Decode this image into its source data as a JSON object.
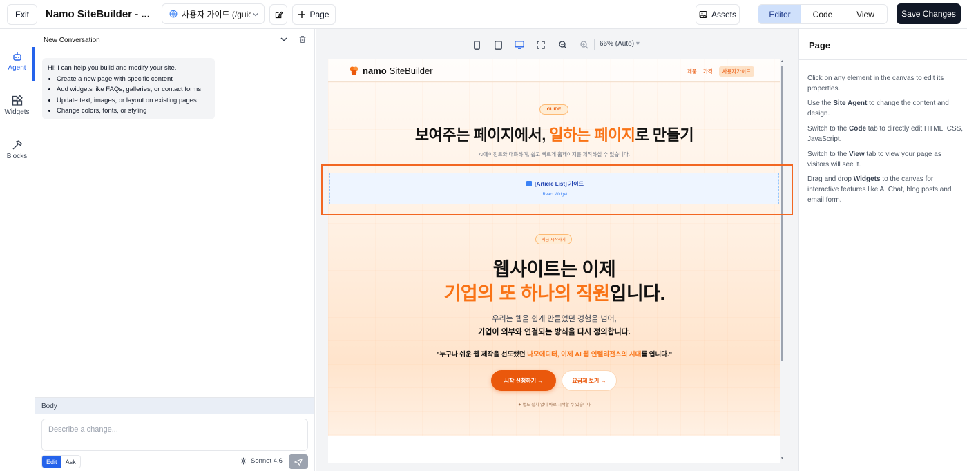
{
  "toolbar": {
    "exit_label": "Exit",
    "app_title": "Namo SiteBuilder - ...",
    "page_selector": "사용자 가이드 (/guide)",
    "add_page_label": "Page",
    "assets_label": "Assets",
    "view_modes": [
      "Editor",
      "Code",
      "View"
    ],
    "active_view_mode": "Editor",
    "save_label": "Save Changes"
  },
  "rail": {
    "items": [
      {
        "label": "Agent",
        "icon": "robot-icon",
        "active": true
      },
      {
        "label": "Widgets",
        "icon": "widgets-icon",
        "active": false
      },
      {
        "label": "Blocks",
        "icon": "hammer-icon",
        "active": false
      }
    ]
  },
  "conversation": {
    "title": "New Conversation",
    "greeting": "Hi! I can help you build and modify your site.",
    "suggestions": [
      "Create a new page with specific content",
      "Add widgets like FAQs, galleries, or contact forms",
      "Update text, images, or layout on existing pages",
      "Change colors, fonts, or styling"
    ],
    "context_label": "Body",
    "input_placeholder": "Describe a change...",
    "modes": [
      "Edit",
      "Ask"
    ],
    "active_mode": "Edit",
    "model": "Sonnet 4.6"
  },
  "canvas": {
    "zoom": "66% (Auto)",
    "site": {
      "logo_brand": "namo",
      "logo_name": "SiteBuilder",
      "nav": [
        "제품",
        "가격",
        "사용자가이드"
      ],
      "guide_badge": "GUIDE",
      "hero_title_a": "보여주는 페이지에서, ",
      "hero_title_highlight": "일하는 페이지",
      "hero_title_b": "로 만들기",
      "hero_subtitle": "AI에이전트와 대화하며, 쉽고 빠르게 홈페이지를 제작하실 수 있습니다.",
      "widget_title": "[Article List] 가이드",
      "widget_subtitle": "React Widget",
      "start_badge": "지금 시작하기",
      "headline_line1": "웹사이트는 이제",
      "headline_highlight": "기업의 또 하나의 직원",
      "headline_tail": "입니다.",
      "desc_line1": "우리는 웹을 쉽게 만들었던 경험을 넘어,",
      "desc_line2": "기업이 외부와 연결되는 방식을 다시 정의합니다.",
      "quote_a": "\"누구나 쉬운 웹 제작을 선도했던 ",
      "quote_highlight": "나모에디터, 이제 AI 웹 인텔리전스의 시대",
      "quote_b": "를 엽니다.\"",
      "cta_primary": "시작 신청하기 →",
      "cta_secondary": "요금제 보기 →",
      "note": "✦ 별도 설치 없이 바로 시작할 수 있습니다"
    }
  },
  "properties": {
    "title": "Page",
    "tips": [
      {
        "parts": [
          {
            "t": "Click on any element in the canvas to edit its properties.",
            "b": false
          }
        ]
      },
      {
        "parts": [
          {
            "t": "Use the ",
            "b": false
          },
          {
            "t": "Site Agent",
            "b": true
          },
          {
            "t": " to change the content and design.",
            "b": false
          }
        ]
      },
      {
        "parts": [
          {
            "t": "Switch to the ",
            "b": false
          },
          {
            "t": "Code",
            "b": true
          },
          {
            "t": " tab to directly edit HTML, CSS, JavaScript.",
            "b": false
          }
        ]
      },
      {
        "parts": [
          {
            "t": "Switch to the ",
            "b": false
          },
          {
            "t": "View",
            "b": true
          },
          {
            "t": " tab to view your page as visitors will see it.",
            "b": false
          }
        ]
      },
      {
        "parts": [
          {
            "t": "Drag and drop ",
            "b": false
          },
          {
            "t": "Widgets",
            "b": true
          },
          {
            "t": " to the canvas for interactive features like AI Chat, blog posts and email form.",
            "b": false
          }
        ]
      }
    ]
  },
  "colors": {
    "accent": "#2563eb",
    "brand_orange": "#f97316",
    "selection_outline": "#f26722",
    "save_button": "#111827"
  }
}
